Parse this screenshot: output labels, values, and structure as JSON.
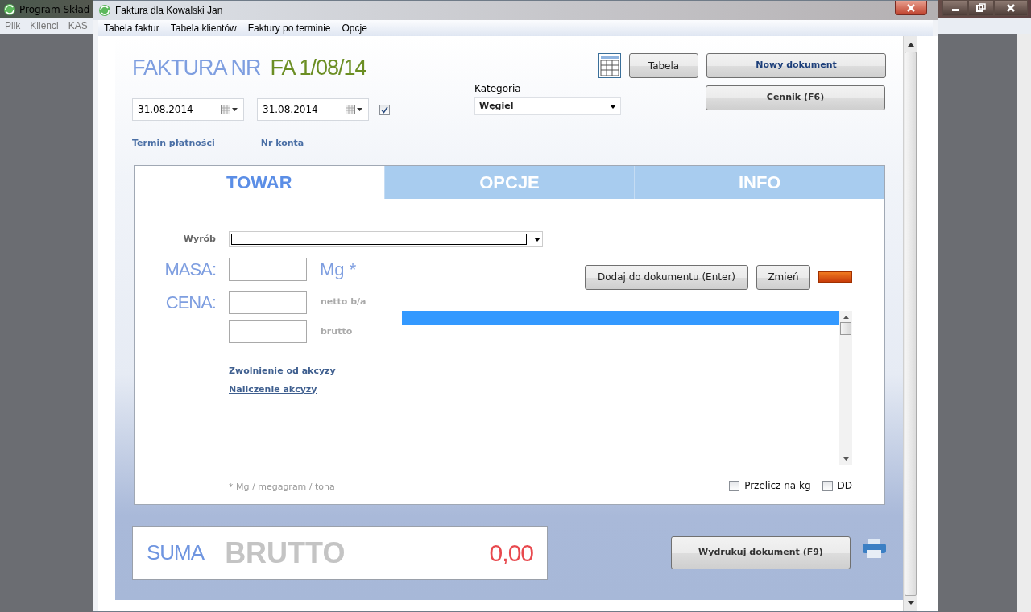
{
  "back_window": {
    "title": "Program Skład",
    "menu": [
      "Plik",
      "Klienci",
      "KAS"
    ]
  },
  "window": {
    "title": "Faktura dla Kowalski Jan"
  },
  "menu": [
    "Tabela faktur",
    "Tabela klientów",
    "Faktury po terminie",
    "Opcje"
  ],
  "header": {
    "label": "FAKTURA NR",
    "number": "FA 1/08/14"
  },
  "dates": [
    {
      "value": "31.08.2014"
    },
    {
      "value": "31.08.2014"
    }
  ],
  "date_checkbox": {
    "checked": true
  },
  "category": {
    "label": "Kategoria",
    "value": "Węgiel"
  },
  "top_buttons": [
    {
      "label": "Tabela",
      "kind": "plain"
    },
    {
      "label": "Nowy dokument",
      "kind": "primary"
    },
    {
      "label": "Cennik (F6)",
      "kind": "bold"
    }
  ],
  "top_links": [
    "Termin płatności",
    "Nr konta"
  ],
  "tabs": [
    {
      "label": "TOWAR",
      "selected": true
    },
    {
      "label": "OPCJE",
      "selected": false
    },
    {
      "label": "INFO",
      "selected": false
    }
  ],
  "product": {
    "label": "Wyrób"
  },
  "mass": {
    "label": "MASA:",
    "unit": "Mg *"
  },
  "price": {
    "label": "CENA:",
    "net": "netto b/a",
    "gross": "brutto"
  },
  "links": [
    {
      "text": "Zwolnienie od akcyzy",
      "underlined": false
    },
    {
      "text": "Naliczenie akcyzy",
      "underlined": true
    }
  ],
  "footnote": "* Mg / megagram / tona",
  "actions": [
    "Dodaj do dokumentu (Enter)",
    "Zmień"
  ],
  "list": {
    "rows": [
      {
        "selected": true
      }
    ]
  },
  "options": [
    {
      "label": "Przelicz na kg",
      "checked": false
    },
    {
      "label": "DD",
      "checked": false
    }
  ],
  "sum": {
    "label": "SUMA",
    "caption": "BRUTTO",
    "value": "0,00"
  },
  "print_button": "Wydrukuj dokument (F9)"
}
